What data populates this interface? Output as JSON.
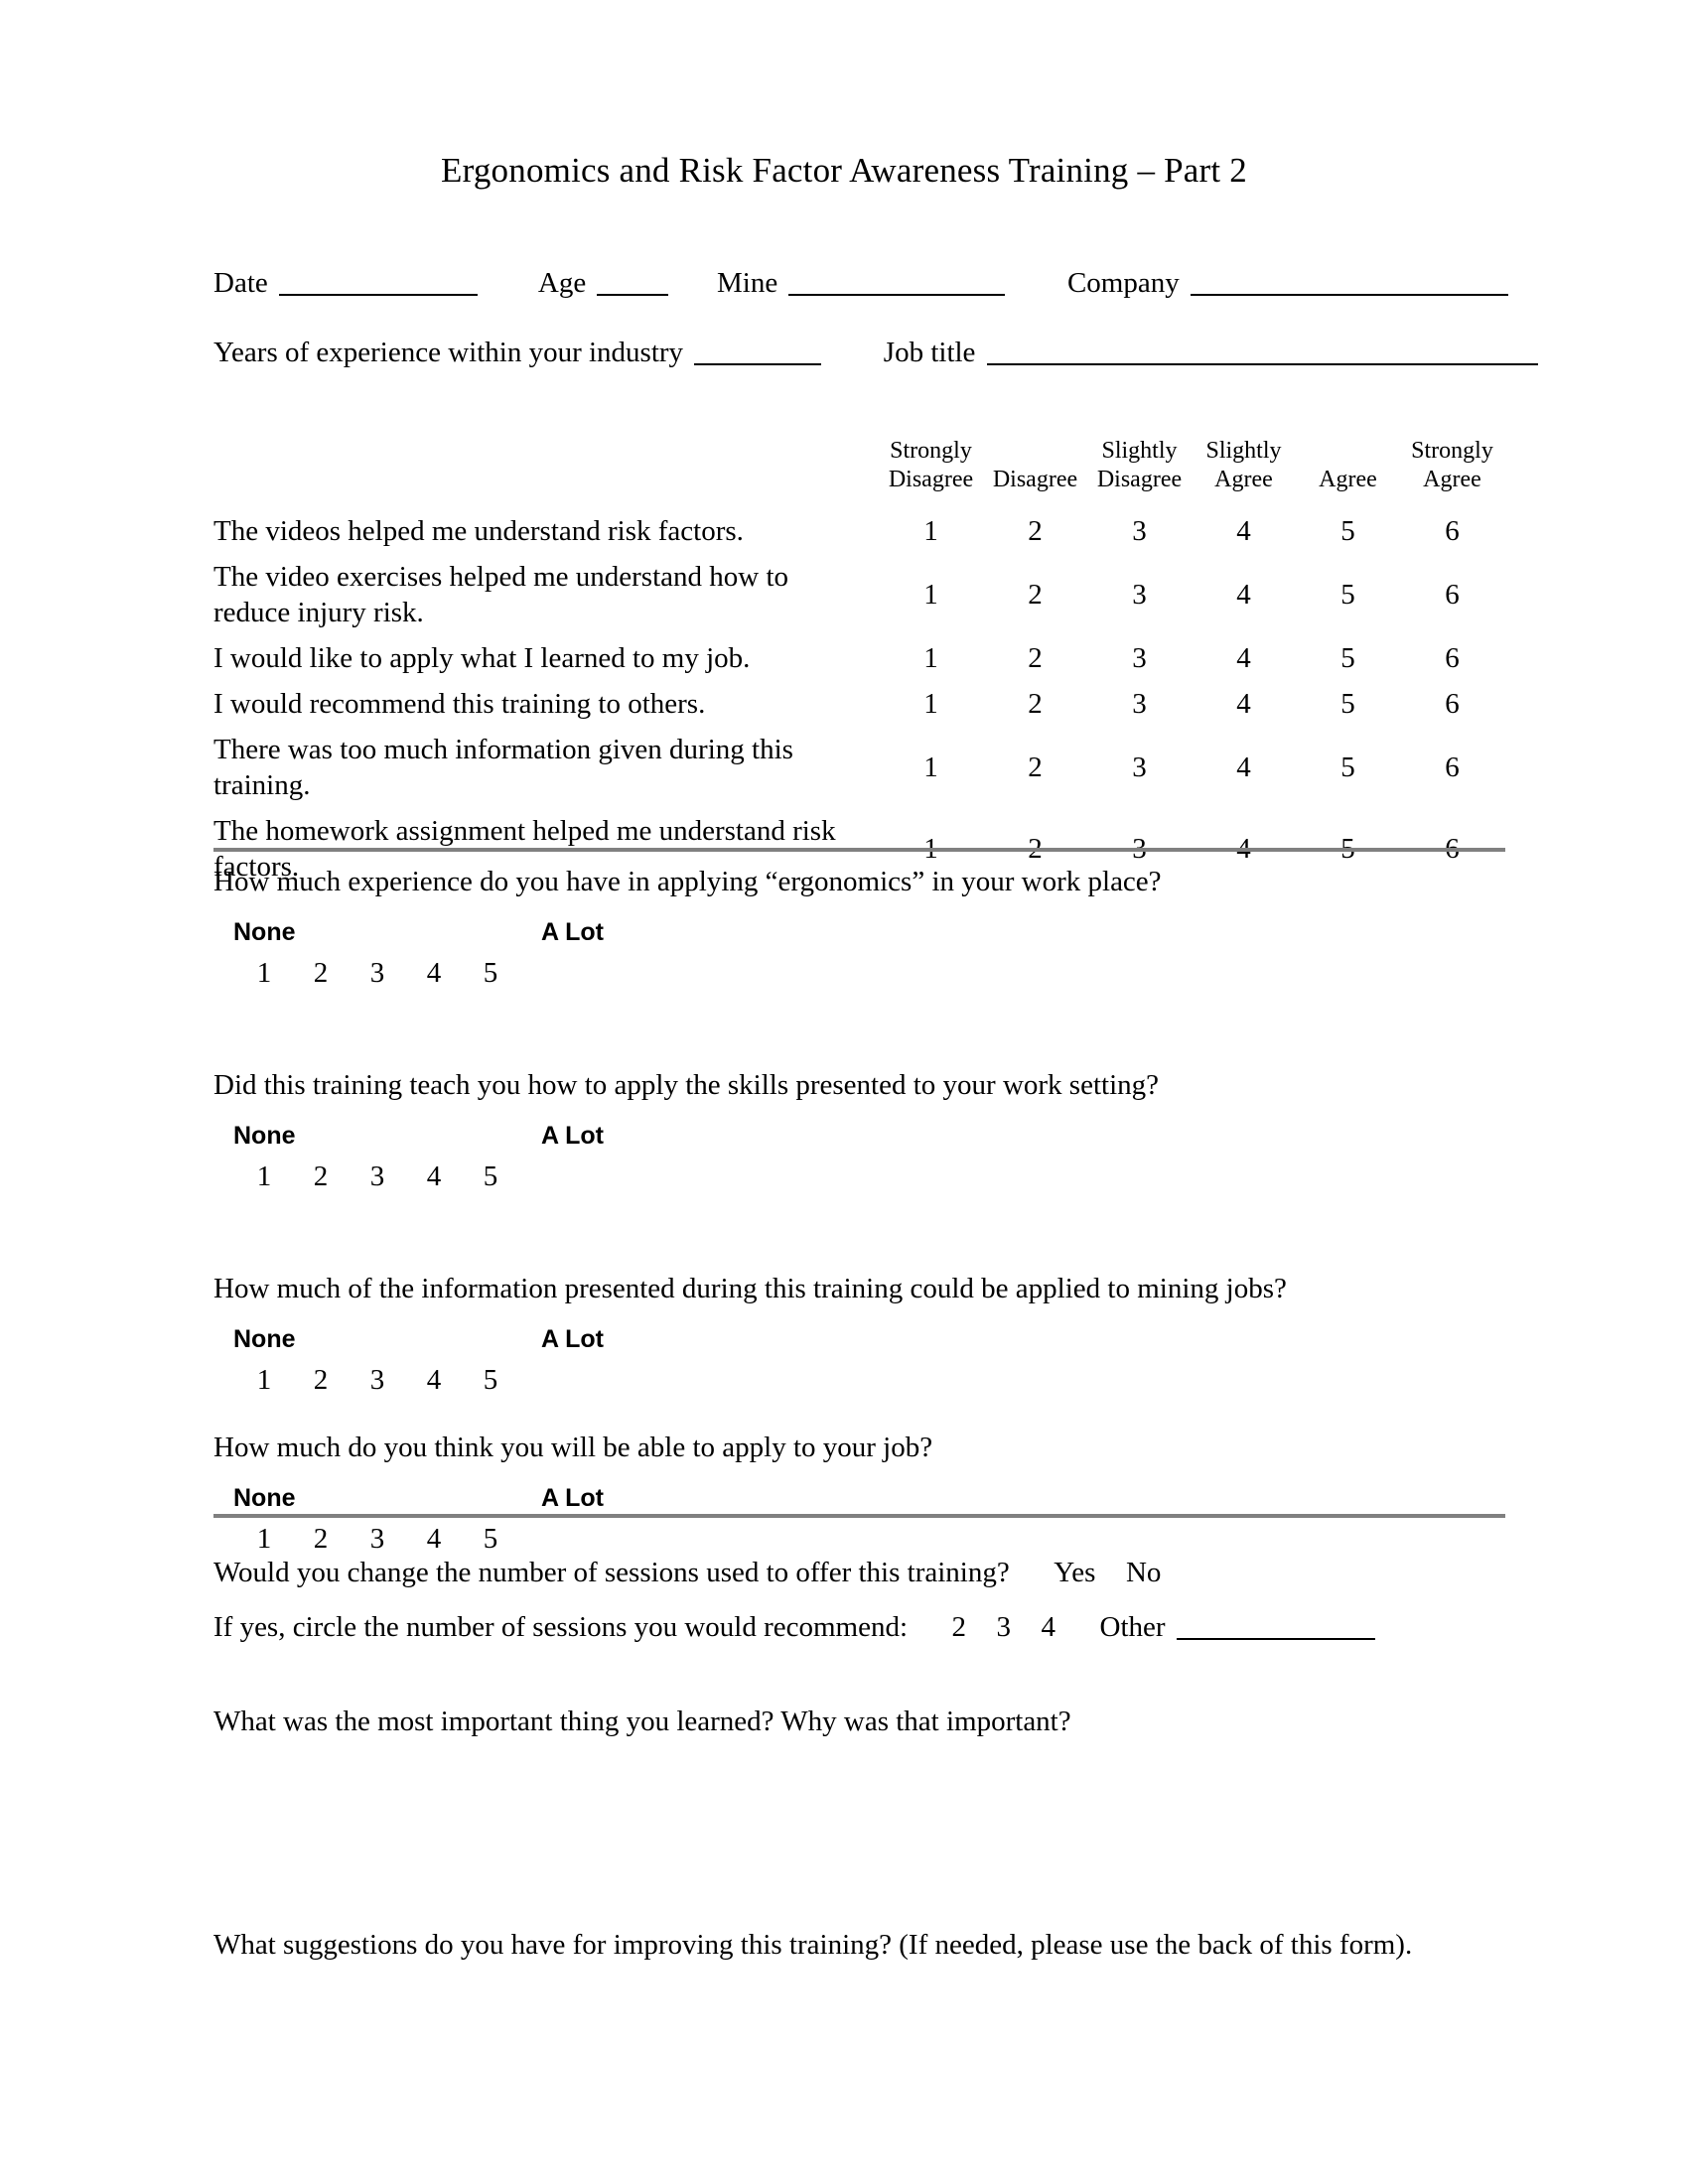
{
  "document": {
    "title": "Ergonomics and Risk Factor Awareness Training – Part 2"
  },
  "identity": {
    "date_label": "Date",
    "age_label": "Age",
    "mine_label": "Mine",
    "company_label": "Company",
    "years_label": "Years of experience within your industry",
    "job_title_label": "Job title"
  },
  "likert": {
    "columns": [
      "Strongly Disagree",
      "Disagree",
      "Slightly Disagree",
      "Slightly Agree",
      "Agree",
      "Strongly Agree"
    ],
    "columns_split": [
      {
        "line1": "Strongly",
        "line2": "Disagree"
      },
      {
        "line1": "",
        "line2": "Disagree"
      },
      {
        "line1": "Slightly",
        "line2": "Disagree"
      },
      {
        "line1": "Slightly",
        "line2": "Agree"
      },
      {
        "line1": "",
        "line2": "Agree"
      },
      {
        "line1": "Strongly",
        "line2": "Agree"
      }
    ],
    "scale_values": [
      "1",
      "2",
      "3",
      "4",
      "5",
      "6"
    ],
    "statements": [
      "The videos helped me understand risk factors.",
      "The video exercises helped me understand how to reduce injury risk.",
      "I would like to apply what I learned to my job.",
      "I would recommend this training to others.",
      "There was too much information given during this training.",
      "The homework assignment helped me understand risk factors."
    ]
  },
  "scale_questions": [
    {
      "question": "How much experience do you have in applying “ergonomics” in your work place?",
      "anchor_low": "None",
      "anchor_high": "A Lot",
      "values": [
        "1",
        "2",
        "3",
        "4",
        "5"
      ]
    },
    {
      "question": "Did this training teach you how to apply the skills presented to your work setting?",
      "anchor_low": "None",
      "anchor_high": "A Lot",
      "values": [
        "1",
        "2",
        "3",
        "4",
        "5"
      ]
    },
    {
      "question": "How much of the information presented during this training could be applied to mining jobs?",
      "anchor_low": "None",
      "anchor_high": "A Lot",
      "values": [
        "1",
        "2",
        "3",
        "4",
        "5"
      ]
    },
    {
      "question": "How much do you think you will be able to apply to your job?",
      "anchor_low": "None",
      "anchor_high": "A Lot",
      "values": [
        "1",
        "2",
        "3",
        "4",
        "5"
      ]
    }
  ],
  "sessions": {
    "change_question": "Would you change the number of sessions used to offer this training?",
    "yes_label": "Yes",
    "no_label": "No",
    "recommend_question": "If yes, circle the number of sessions you would recommend:",
    "options": [
      "2",
      "3",
      "4"
    ],
    "other_label": "Other"
  },
  "open_questions": [
    "What was the most important thing you learned?  Why was that important?",
    "What suggestions do you have for improving this training?  (If needed, please use the back of this form)."
  ],
  "colors": {
    "text": "#000000",
    "divider": "#808080",
    "background": "#ffffff"
  }
}
